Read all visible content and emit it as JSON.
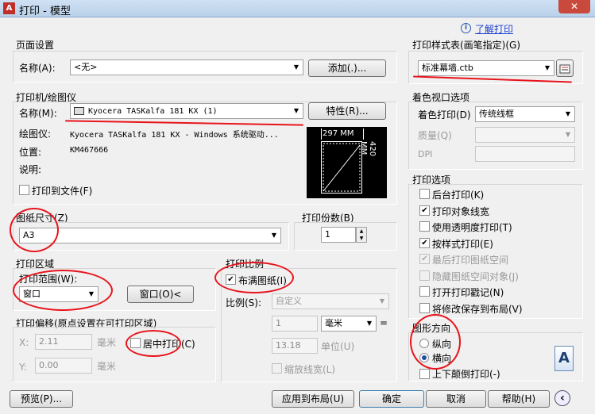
{
  "window": {
    "title": "打印 - 模型",
    "close": "✕"
  },
  "help_link": "了解打印",
  "page_setup": {
    "group": "页面设置",
    "name_label": "名称(A):",
    "name_value": "<无>",
    "add_button": "添加(.)..."
  },
  "printer": {
    "group": "打印机/绘图仪",
    "name_label": "名称(M):",
    "name_value": "Kyocera TASKalfa 181 KX (1)",
    "properties_button": "特性(R)...",
    "plotter_label": "绘图仪:",
    "plotter_value": "Kyocera TASKalfa 181 KX - Windows 系统驱动...",
    "location_label": "位置:",
    "location_value": "KM467666",
    "description_label": "说明:",
    "print_to_file": "打印到文件(F)"
  },
  "preview": {
    "width_text": "297 MM",
    "height_text": "420 MM"
  },
  "paper_size": {
    "group": "图纸尺寸(Z)",
    "value": "A3"
  },
  "copies": {
    "group": "打印份数(B)",
    "value": "1"
  },
  "plot_area": {
    "group": "打印区域",
    "range_label": "打印范围(W):",
    "range_value": "窗口",
    "window_button": "窗口(O)<"
  },
  "plot_offset": {
    "group": "打印偏移(原点设置在可打印区域)",
    "x_label": "X:",
    "x_value": "2.11",
    "y_label": "Y:",
    "y_value": "0.00",
    "unit": "毫米",
    "center": "居中打印(C)"
  },
  "plot_scale": {
    "group": "打印比例",
    "fit": "布满图纸(I)",
    "scale_label": "比例(S):",
    "scale_value": "自定义",
    "val1": "1",
    "unit_value": "毫米",
    "eq": "=",
    "val2": "13.18",
    "unit_label": "单位(U)",
    "scale_lineweights": "缩放线宽(L)"
  },
  "style_table": {
    "group": "打印样式表(画笔指定)(G)",
    "value": "标准幕墙.ctb"
  },
  "shaded": {
    "group": "着色视口选项",
    "shade_label": "着色打印(D)",
    "shade_value": "传统线框",
    "quality_label": "质量(Q)",
    "dpi_label": "DPI"
  },
  "options": {
    "group": "打印选项",
    "items": [
      {
        "label": "后台打印(K)",
        "checked": false,
        "disabled": false
      },
      {
        "label": "打印对象线宽",
        "checked": true,
        "disabled": false
      },
      {
        "label": "使用透明度打印(T)",
        "checked": false,
        "disabled": false
      },
      {
        "label": "按样式打印(E)",
        "checked": true,
        "disabled": false
      },
      {
        "label": "最后打印图纸空间",
        "checked": true,
        "disabled": true
      },
      {
        "label": "隐藏图纸空间对象(J)",
        "checked": false,
        "disabled": true
      },
      {
        "label": "打开打印戳记(N)",
        "checked": false,
        "disabled": false
      },
      {
        "label": "将修改保存到布局(V)",
        "checked": false,
        "disabled": false
      }
    ]
  },
  "orientation": {
    "group": "图形方向",
    "portrait": "纵向",
    "landscape": "横向",
    "upside_down": "上下颠倒打印(-)",
    "preview_letter": "A"
  },
  "footer": {
    "preview": "预览(P)...",
    "apply": "应用到布局(U)",
    "ok": "确定",
    "cancel": "取消",
    "help": "帮助(H)",
    "more_icon": "‹"
  }
}
